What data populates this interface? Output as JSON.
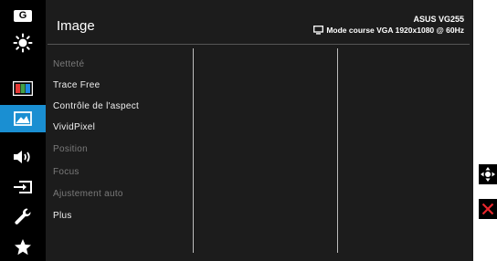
{
  "header": {
    "title": "Image",
    "model": "ASUS VG255",
    "mode": "Mode course VGA 1920x1080 @ 60Hz"
  },
  "sidebar": {
    "items": [
      {
        "icon": "gaming-icon",
        "label": "G"
      },
      {
        "icon": "brightness-icon"
      },
      {
        "icon": "color-icon"
      },
      {
        "icon": "image-icon",
        "active": true
      },
      {
        "icon": "sound-icon"
      },
      {
        "icon": "input-select-icon"
      },
      {
        "icon": "system-setup-icon"
      },
      {
        "icon": "favorite-icon"
      }
    ]
  },
  "menu": {
    "items": [
      {
        "label": "Netteté",
        "enabled": false
      },
      {
        "label": "Trace Free",
        "enabled": true
      },
      {
        "label": "Contrôle de l'aspect",
        "enabled": true
      },
      {
        "label": "VividPixel",
        "enabled": true
      },
      {
        "label": "Position",
        "enabled": false
      },
      {
        "label": "Focus",
        "enabled": false
      },
      {
        "label": "Ajustement auto",
        "enabled": false
      },
      {
        "label": "Plus",
        "enabled": true
      }
    ]
  },
  "external_keys": [
    {
      "icon": "five-way-navigation-icon"
    },
    {
      "icon": "close-icon",
      "color": "#e8262c"
    }
  ],
  "colors": {
    "active": "#1a8fd2",
    "panel": "#1c1c1c",
    "sidebar": "#000000"
  }
}
